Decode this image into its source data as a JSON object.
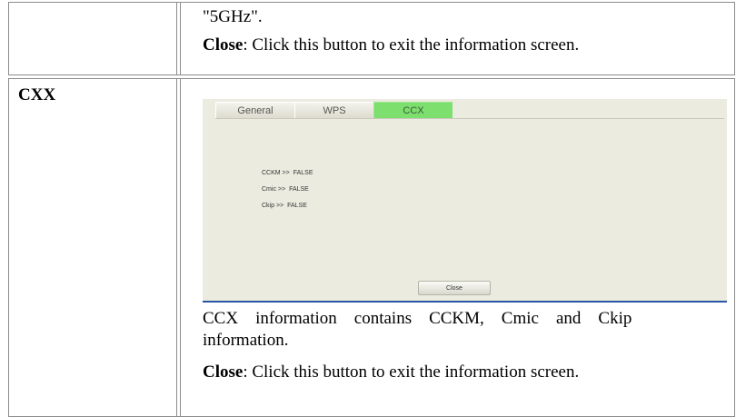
{
  "row1": {
    "line1": "\"5GHz\".",
    "close_label": "Close",
    "close_desc": ": Click this button to exit the information screen."
  },
  "row2": {
    "term": "CXX",
    "dialog": {
      "tabs": [
        "General",
        "WPS",
        "CCX"
      ],
      "active_tab": "CCX",
      "fields": [
        {
          "key": "CCKM >>",
          "value": "FALSE"
        },
        {
          "key": "Cmic >>",
          "value": "FALSE"
        },
        {
          "key": "Ckip >>",
          "value": "FALSE"
        }
      ],
      "close_button": "Close",
      "colors": {
        "background": "#ecebe0",
        "active_tab": "#7ddf6e",
        "border_bottom": "#2a55a4"
      }
    },
    "desc_line1": "CCX    information    contains    CCKM,    Cmic    and    Ckip",
    "desc_line2": "information.",
    "close_label": "Close",
    "close_desc": ": Click this button to exit the information screen."
  }
}
